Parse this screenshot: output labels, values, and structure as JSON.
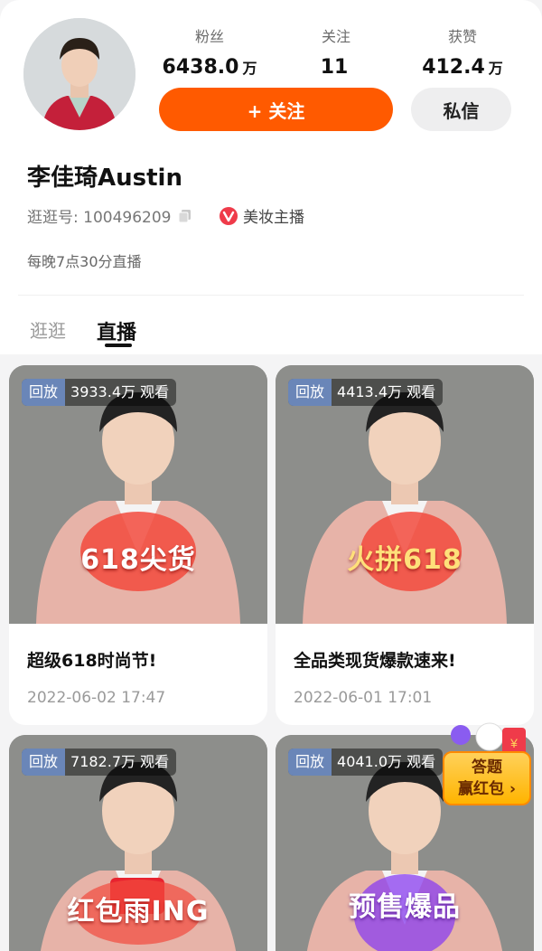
{
  "profile": {
    "stats": [
      {
        "label": "粉丝",
        "value": "6438.0",
        "unit": "万"
      },
      {
        "label": "关注",
        "value": "11",
        "unit": ""
      },
      {
        "label": "获赞",
        "value": "412.4",
        "unit": "万"
      }
    ],
    "follow_label": "+ 关注",
    "dm_label": "私信",
    "name": "李佳琦Austin",
    "id_label": "逛逛号: 100496209",
    "tag_label": "美妆主播",
    "bio": "每晚7点30分直播"
  },
  "tabs": [
    {
      "label": "逛逛",
      "active": false
    },
    {
      "label": "直播",
      "active": true
    }
  ],
  "cards": [
    {
      "badge": "回放",
      "views": "3933.4万 观看",
      "overlay": "618尖货",
      "title": "超级618时尚节!",
      "time": "2022-06-02 17:47"
    },
    {
      "badge": "回放",
      "views": "4413.4万 观看",
      "overlay": "火拼618",
      "title": "全品类现货爆款速来!",
      "time": "2022-06-01 17:01"
    },
    {
      "badge": "回放",
      "views": "7182.7万 观看",
      "overlay": "红包雨ING",
      "title": "",
      "time": ""
    },
    {
      "badge": "回放",
      "views": "4041.0万 观看",
      "overlay": "预售爆品",
      "title": "",
      "time": ""
    }
  ],
  "floating_widget": {
    "line1": "答题",
    "line2": "赢红包 ›"
  },
  "colors": {
    "accent": "#ff5a00",
    "replay_badge": "#6a86b8",
    "tag_icon": "#ef3b4a"
  },
  "icons": [
    "copy-icon",
    "verified-v-icon",
    "plus-icon"
  ]
}
